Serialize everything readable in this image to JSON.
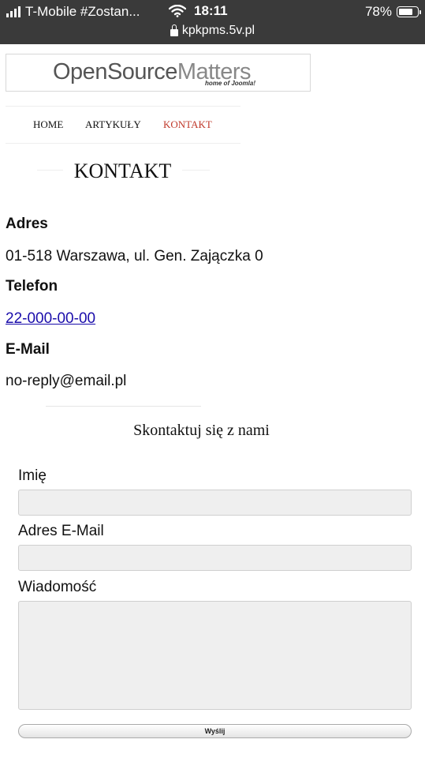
{
  "status_bar": {
    "carrier": "T-Mobile #Zostan...",
    "time": "18:11",
    "battery": "78%",
    "url": "kpkpms.5v.pl"
  },
  "logo": {
    "main_a": "OpenSource",
    "main_b": "Matters",
    "tagline": "home of Joomla!"
  },
  "nav": {
    "items": [
      {
        "label": "HOME"
      },
      {
        "label": "ARTYKUŁY"
      },
      {
        "label": "KONTAKT"
      }
    ]
  },
  "page": {
    "title": "KONTAKT",
    "address_label": "Adres",
    "address_value": "01-518 Warszawa, ul. Gen. Zajączka 0",
    "phone_label": "Telefon",
    "phone_value": "22-000-00-00",
    "email_label": "E-Mail",
    "email_value": "no-reply@email.pl"
  },
  "form": {
    "title": "Skontaktuj się z nami",
    "name_label": "Imię",
    "email_label": "Adres E-Mail",
    "message_label": "Wiadomość",
    "submit_label": "Wyślij"
  },
  "colors": {
    "status_bg": "#3a3a3a",
    "active_nav": "#c0392b",
    "link": "#1a0dab"
  }
}
